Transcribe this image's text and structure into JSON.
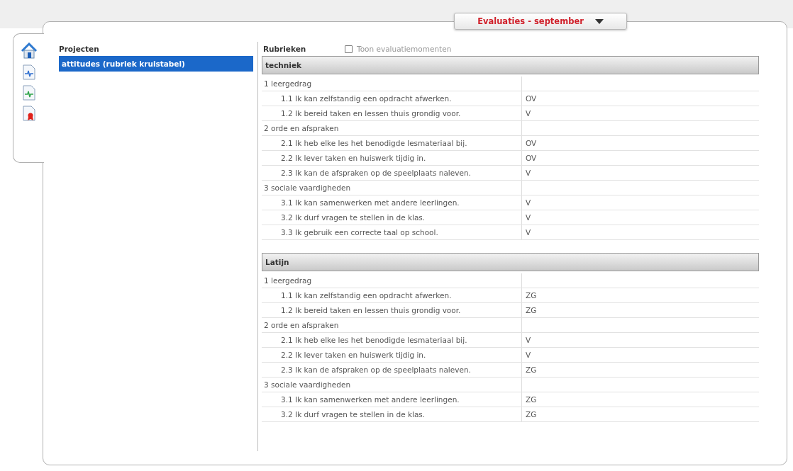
{
  "period_menu": {
    "label": "Evaluaties - september"
  },
  "sidebar": {
    "items": [
      {
        "kind": "home"
      },
      {
        "kind": "doc-blue"
      },
      {
        "kind": "doc-green"
      },
      {
        "kind": "doc-ribbon"
      }
    ]
  },
  "projects": {
    "heading": "Projecten",
    "items": [
      {
        "label": "attitudes (rubriek kruistabel)",
        "selected": true
      }
    ]
  },
  "rubrics": {
    "heading": "Rubrieken",
    "toggle": {
      "label": "Toon evaluatiemomenten",
      "checked": false
    },
    "sections": [
      {
        "title": "techniek",
        "groups": [
          {
            "label": "1 leergedrag",
            "items": [
              {
                "label": "1.1 Ik kan zelfstandig een opdracht afwerken.",
                "value": "OV"
              },
              {
                "label": "1.2 Ik bereid taken en lessen thuis grondig voor.",
                "value": "V"
              }
            ]
          },
          {
            "label": "2 orde en afspraken",
            "items": [
              {
                "label": "2.1 Ik heb elke les het benodigde lesmateriaal bij.",
                "value": "OV"
              },
              {
                "label": "2.2 Ik lever taken en huiswerk tijdig in.",
                "value": "OV"
              },
              {
                "label": "2.3 Ik kan de afspraken op de speelplaats naleven.",
                "value": "V"
              }
            ]
          },
          {
            "label": "3 sociale vaardigheden",
            "items": [
              {
                "label": "3.1 Ik kan samenwerken met andere leerlingen.",
                "value": "V"
              },
              {
                "label": "3.2 Ik durf vragen te stellen in de klas.",
                "value": "V"
              },
              {
                "label": "3.3 Ik gebruik een correcte taal op school.",
                "value": "V"
              }
            ]
          }
        ]
      },
      {
        "title": "Latijn",
        "groups": [
          {
            "label": "1 leergedrag",
            "items": [
              {
                "label": "1.1 Ik kan zelfstandig een opdracht afwerken.",
                "value": "ZG"
              },
              {
                "label": "1.2 Ik bereid taken en lessen thuis grondig voor.",
                "value": "ZG"
              }
            ]
          },
          {
            "label": "2 orde en afspraken",
            "items": [
              {
                "label": "2.1 Ik heb elke les het benodigde lesmateriaal bij.",
                "value": "V"
              },
              {
                "label": "2.2 Ik lever taken en huiswerk tijdig in.",
                "value": "V"
              },
              {
                "label": "2.3 Ik kan de afspraken op de speelplaats naleven.",
                "value": "ZG"
              }
            ]
          },
          {
            "label": "3 sociale vaardigheden",
            "items": [
              {
                "label": "3.1 Ik kan samenwerken met andere leerlingen.",
                "value": "ZG"
              },
              {
                "label": "3.2 Ik durf vragen te stellen in de klas.",
                "value": "ZG"
              }
            ]
          }
        ]
      }
    ]
  }
}
